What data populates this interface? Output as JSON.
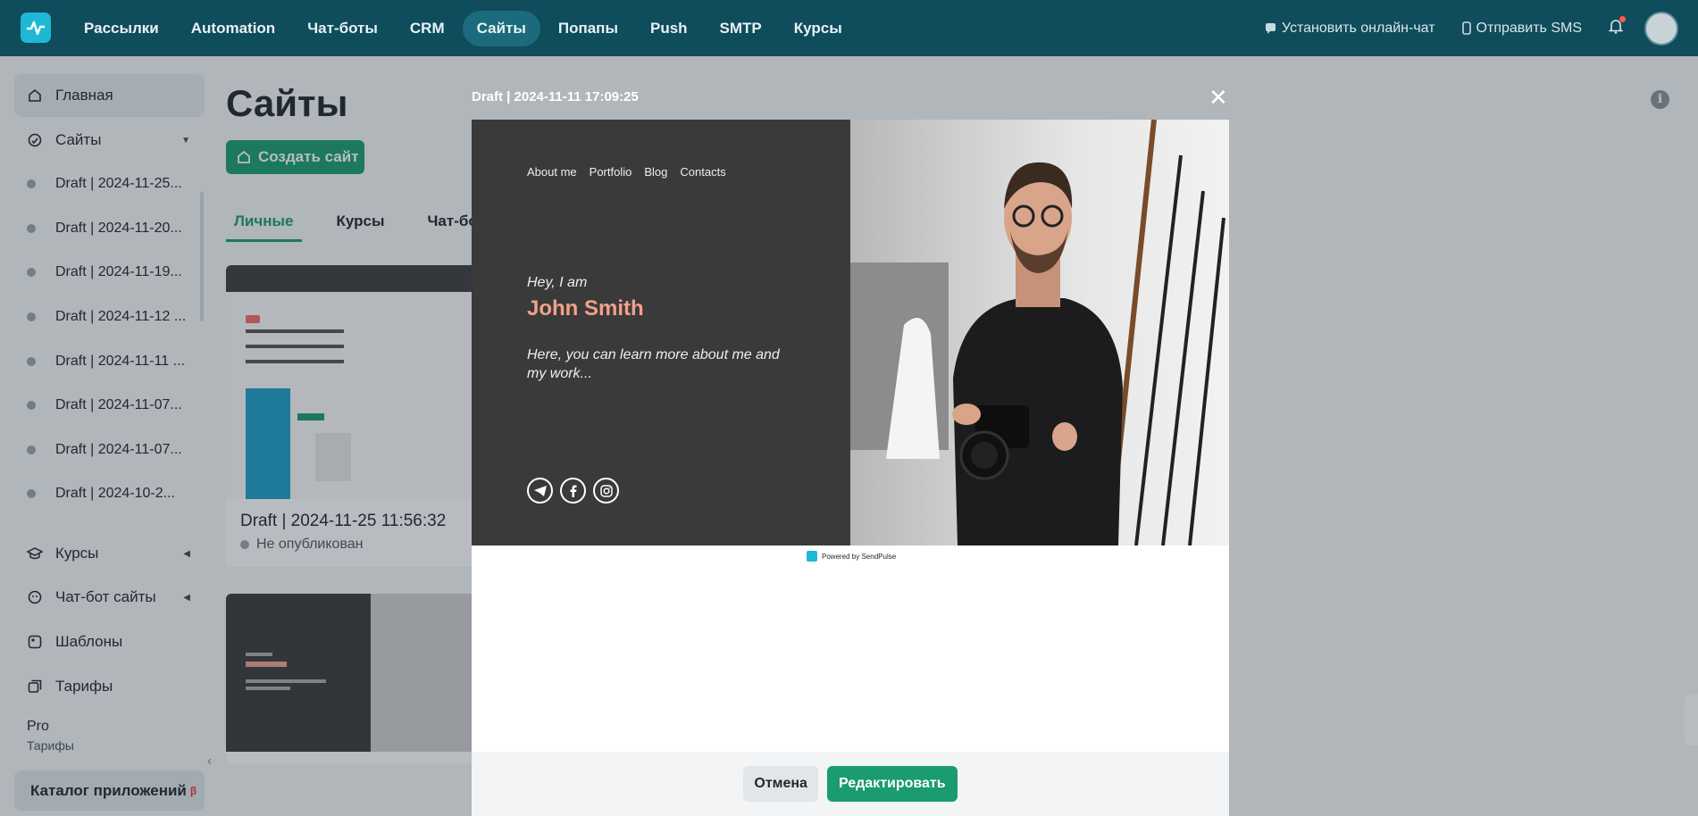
{
  "topnav": {
    "items": [
      "Рассылки",
      "Automation",
      "Чат-боты",
      "CRM",
      "Сайты",
      "Попапы",
      "Push",
      "SMTP",
      "Курсы"
    ],
    "install_chat": "Установить онлайн-чат",
    "send_sms": "Отправить SMS"
  },
  "sidebar": {
    "home": "Главная",
    "sites": "Сайты",
    "site_list": [
      "Draft | 2024-11-25...",
      "Draft | 2024-11-20...",
      "Draft | 2024-11-19...",
      "Draft | 2024-11-12 ...",
      "Draft | 2024-11-11 ...",
      "Draft | 2024-11-07...",
      "Draft | 2024-11-07...",
      "Draft | 2024-10-2..."
    ],
    "courses": "Курсы",
    "chatbot_sites": "Чат-бот сайты",
    "templates": "Шаблоны",
    "tariffs": "Тарифы",
    "plan": "Pro",
    "plan_sub": "Тарифы",
    "catalog": "Каталог приложений",
    "catalog_badge": "β"
  },
  "main": {
    "title": "Сайты",
    "create_button": "Создать сайт",
    "tabs": [
      "Личные",
      "Курсы",
      "Чат-бот сайты"
    ],
    "cards": [
      {
        "name": "Draft | 2024-11-25 11:56:32",
        "status": "Не опубликован"
      }
    ]
  },
  "modal": {
    "title": "Draft | 2024-11-11 17:09:25",
    "close": "✕",
    "preview": {
      "menu": [
        "About me",
        "Portfolio",
        "Blog",
        "Contacts"
      ],
      "greeting": "Hey, I am",
      "name": "John Smith",
      "description": "Here, you can learn more about me and my work...",
      "powered": "Powered by SendPulse"
    },
    "cancel_button": "Отмена",
    "edit_button": "Редактировать"
  },
  "colors": {
    "nav_bg": "#0f4c5c",
    "accent_green": "#1a9b70",
    "preview_name": "#f2a189"
  }
}
